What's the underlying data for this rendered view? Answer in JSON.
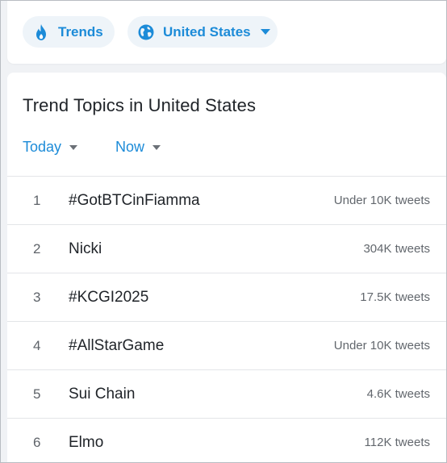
{
  "filters": {
    "trends_label": "Trends",
    "country_label": "United States"
  },
  "main": {
    "title": "Trend Topics in United States",
    "date_dropdown": "Today",
    "time_dropdown": "Now",
    "trends": [
      {
        "rank": "1",
        "name": "#GotBTCinFiamma",
        "count": "Under 10K tweets"
      },
      {
        "rank": "2",
        "name": "Nicki",
        "count": "304K tweets"
      },
      {
        "rank": "3",
        "name": "#KCGI2025",
        "count": "17.5K tweets"
      },
      {
        "rank": "4",
        "name": "#AllStarGame",
        "count": "Under 10K tweets"
      },
      {
        "rank": "5",
        "name": "Sui Chain",
        "count": "4.6K tweets"
      },
      {
        "rank": "6",
        "name": "Elmo",
        "count": "112K tweets"
      }
    ]
  },
  "colors": {
    "accent": "#1c8bd8",
    "pill_bg": "#eef4f9",
    "page_bg": "#f0f2f5"
  },
  "icons": {
    "trends": "fire-icon",
    "country": "globe-icon",
    "dropdown": "caret-down-icon"
  }
}
